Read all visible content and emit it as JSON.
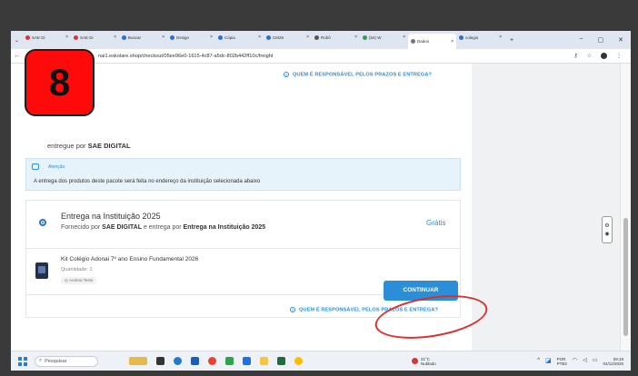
{
  "browser": {
    "tabs": [
      {
        "label": "SAE Di",
        "color": "#d9343a"
      },
      {
        "label": "SAE Di",
        "color": "#d9343a"
      },
      {
        "label": "Buscar",
        "color": "#2a6fd6"
      },
      {
        "label": "Design",
        "color": "#2a6fd6"
      },
      {
        "label": "Cópia",
        "color": "#2a6fd6"
      },
      {
        "label": "CM26",
        "color": "#2a6fd6"
      },
      {
        "label": "Robô",
        "color": "#555555"
      },
      {
        "label": "(54) W",
        "color": "#2aa44f"
      },
      {
        "label": "Dados",
        "color": "#777777",
        "active": true
      },
      {
        "label": "colegio",
        "color": "#2a6fd6"
      }
    ],
    "new_tab": "+",
    "close_x": "×",
    "win_minimize": "−",
    "win_restore": "▢",
    "win_close": "✕",
    "back": "←",
    "url": "nai1.eskolare.shop/checkout/05ee96e0-1615-4c87-a5dc-802b442ff10c/freight"
  },
  "checkout": {
    "top_link": "QUEM É RESPONSÁVEL PELOS PRAZOS E ENTREGA?",
    "subtitle_prefix": "entregue por",
    "subtitle_vendor": "SAE DIGITAL",
    "alert_title": "Atenção",
    "alert_text": "A entrega dos produtos deste pacote será feita no endereço da instituição selecionada abaixo",
    "option_title": "Entrega na Instituição 2025",
    "option_desc_1": "Fornecido por",
    "option_vendor": "SAE DIGITAL",
    "option_desc_2": "e entrega por",
    "option_delivery": "Entrega na Instituição 2025",
    "option_price": "Grátis",
    "product_name": "Kit Colégio Adonai 7º ano Ensino Fundamental 2026",
    "product_qty": "Quantidade: 1",
    "product_user": "Andrea Teste",
    "bottom_link": "QUEM É RESPONSÁVEL PELOS PRAZOS E ENTREGA?",
    "continue_button": "CONTINUAR"
  },
  "badge": "8",
  "taskbar": {
    "search_placeholder": "Pesquisar",
    "weather_temp": "21°C",
    "weather_desc": "Nublado",
    "lang_1": "POR",
    "lang_2": "PTB2",
    "time": "09:19",
    "date": "04/12/2025"
  },
  "colors": {
    "accent": "#2a8fd6",
    "badge": "#ff0a0a",
    "annotation": "#d93030"
  }
}
